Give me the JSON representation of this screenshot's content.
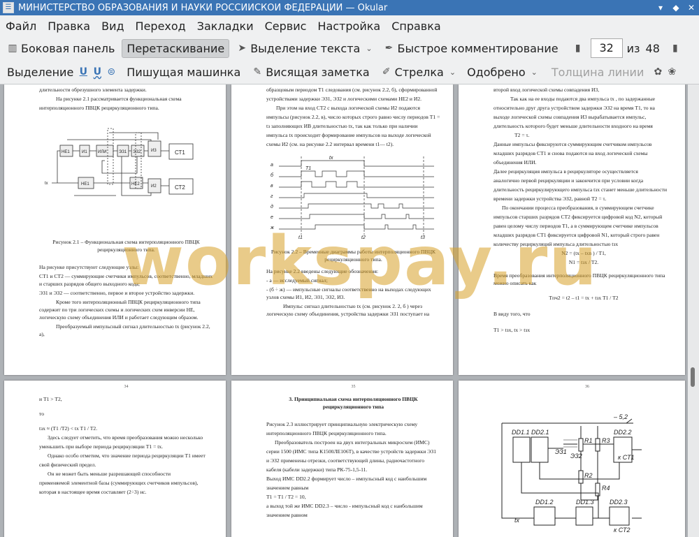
{
  "window": {
    "title": "МИНИСТЕРСТВО ОБРАЗОВАНИЯ И НАУКИ РОССИЙСКОЙ ФЕДЕРАЦИИ  — Okular"
  },
  "menu": [
    "Файл",
    "Правка",
    "Вид",
    "Переход",
    "Закладки",
    "Сервис",
    "Настройка",
    "Справка"
  ],
  "toolbar": {
    "sidebar": "Боковая панель",
    "drag": "Перетаскивание",
    "text_select": "Выделение текста",
    "quick_comment": "Быстрое комментирование",
    "page_current": "32",
    "page_of": "из",
    "page_total": "48"
  },
  "annot_toolbar": {
    "highlight": "Выделение",
    "typewriter": "Пишущая машинка",
    "note": "Висящая заметка",
    "arrow": "Стрелка",
    "approved": "Одобрено",
    "line_width": "Толщина линии"
  },
  "watermark": "workspay.ru",
  "pages": {
    "p1": {
      "lines": [
        "длительности обрезушного элемента задержки.",
        "На рисунке 2.1 рассматривается функциональная схема",
        "интерполяционного ПВЦК рециркуляционного типа."
      ],
      "caption": "Рисунок 2.1 – Функциональная схема интерполяционного ПВЦК рециркуляционного типа.",
      "body": [
        "На рисунке присутствуют следующие узлы:",
        "СТ1 и СТ2 — суммирующие счетчики импульсов, соответственно, младших и старших разрядов общего выходного кода;",
        "ЭЗ1 и ЭЗ2 — соответственно, первое и второе устройство задержки.",
        "Кроме того интерполяционный ПВЦК рециркуляционного типа содержит по три логических схемы и логических схем инверсии НЕ, логическую схему объединения ИЛИ и работает следующим образом.",
        "Преобразуемый импульсный сигнал длительностью tx (рисунок 2.2, а),"
      ]
    },
    "p2": {
      "lines": [
        "образцовым периодом T1 следования (см. рисунок 2.2, б), сформированной",
        "устройствами задержки ЭЗ1, ЭЗ2 и логическими схемами НЕ2 и И2.",
        "При этом на вход СТ2 с выхода логической схемы И2 подаются",
        "импульсы (рисунок 2.2, в), число которых строго равно числу периодов T1 =",
        "tз заполняющих ИВ длительностью tx, так как только при наличии",
        "импульса tx происходит формирование импульсов на выходе логической",
        "схемы И2 (см. на рисунке 2.2 интервал времени t1— t2)."
      ],
      "caption": "Рисунок 2.2 – Временные диаграммы работы интерполяционного ПВЦК рециркуляционного типа.",
      "body": [
        "На рисунке 2.2 введены следующие обозначения:",
        "- а — исследуемый сигнал;",
        "- (б ÷ ж) — импульсные сигналы соответственно на выходах следующих узлов схемы И1, И2, ЭЗ1, ЭЗ2, И3.",
        "Импульс сигнал длительностью tx (см. рисунок 2. 2, б ) через логическую схему объединения, устройства задержки ЭЗ1 поступает на"
      ],
      "labels": [
        "а",
        "б",
        "в",
        "г",
        "д",
        "е",
        "ж",
        "t1",
        "t2",
        "t3",
        "tx",
        "T1"
      ]
    },
    "p3": {
      "lines": [
        "второй вход логической схемы совпадения И3,",
        "Так как на ее входы подаются два импульса tx , по задержанные",
        "относительно друг друга устройством задержки ЭЗ2 на время T1, то на",
        "выходе логической схемы совпадения И3 вырабатывается импульс,",
        "длительность которого будет меньше длительности входного на время",
        "T2 = τ.",
        "Данные импульсы фиксируются суммирующим счетчиком импульсов",
        "младших разрядов СТ1 и снова подаются на вход логической схемы",
        "объединения ИЛИ.",
        "Далее рециркуляция импульса в рециркуляторе осуществляется",
        "аналогично первой рециркуляции и закончится при условии когда",
        "длительность рециркулирующего импульса tзx станет меньше длительности",
        "времени задержки устройства ЭЗ2, равной T2 = τ.",
        "По окончании процесса преобразования, в суммирующем счетчике",
        "импульсов старших разрядов СТ2 фиксируется цифровой код N2, который",
        "равен целому числу периодов T1, а в суммирующем счетчике импульсов",
        "младших разрядов СТ1 фиксируется цифровой N1, который строго равен",
        "количеству рециркуляций импульса длительностью tзx"
      ],
      "formula1": "N2 = (tx – txn ) / T1,",
      "formula2": "N1 = tзx / T2.",
      "text2": "Время преобразования интерполяционного ПВЦК рециркуляционного типа можно описать как",
      "formula3": "Tпч2 = t2 – t1 = tx + tзx T1 / T2",
      "text3": "В виду того, что",
      "formula4": "T1 > tзx, tx > tзx"
    },
    "p4": {
      "num": "34",
      "lines": [
        "и T1 > T2,",
        "то",
        "tзх ≈ (T1 /T2) < tx T1 / T2.",
        "Здесь следует отметить, что время преобразования можно несколько",
        "уменьшить при выборе периода рециркуляции T1 = tx.",
        "Однако особо отметим, что значение периода рециркуляции T1 имеет",
        "свой физический предел.",
        "Он не может быть меньше разрешающей способности",
        "применяемой элементной базы (суммирующих счетчиков импульсов),",
        "которая в настоящее время составляет (2÷3) нс."
      ]
    },
    "p5": {
      "num": "35",
      "heading": "3. Принципиальная схема интерполяционного ПВЦК рециркуляционного типа",
      "lines": [
        "Рисунок 2.3 иллюстрирует принципиальную электрическую схему",
        "интерполяционного ПВЦК рециркуляционного типа.",
        "Преобразователь построен на двух интегральных микросхем (ИМС)",
        "серии 1500 (ИМС типа К1500ЛЕ106Т), в качестве устройств задержки ЭЗ1",
        "и ЭЗ2 применены отрезки, соответствующей длины, радиочастотного",
        "кабеля (кабели задержки) типа РК-75-1,5-11.",
        "Выход ИМС DD2.2 формирует число – импульсный код с наибольшим",
        "значением равным",
        "T1 = T1 / T2 = 10,",
        "а выход той же ИМС DD2.3 – число - импульсный код с наибольшим",
        "значением равном"
      ]
    },
    "p6": {
      "num": "36",
      "labels": [
        "DD1.1",
        "DD2.1",
        "R1",
        "R3",
        "– 5,2",
        "DD2.2",
        "ЭЗ1",
        "ЭЗ2",
        "к СТ1",
        "R2",
        "R4",
        "DD1.2",
        "tx",
        "DD1.3",
        "DD2.3",
        "к СТ2"
      ]
    }
  }
}
